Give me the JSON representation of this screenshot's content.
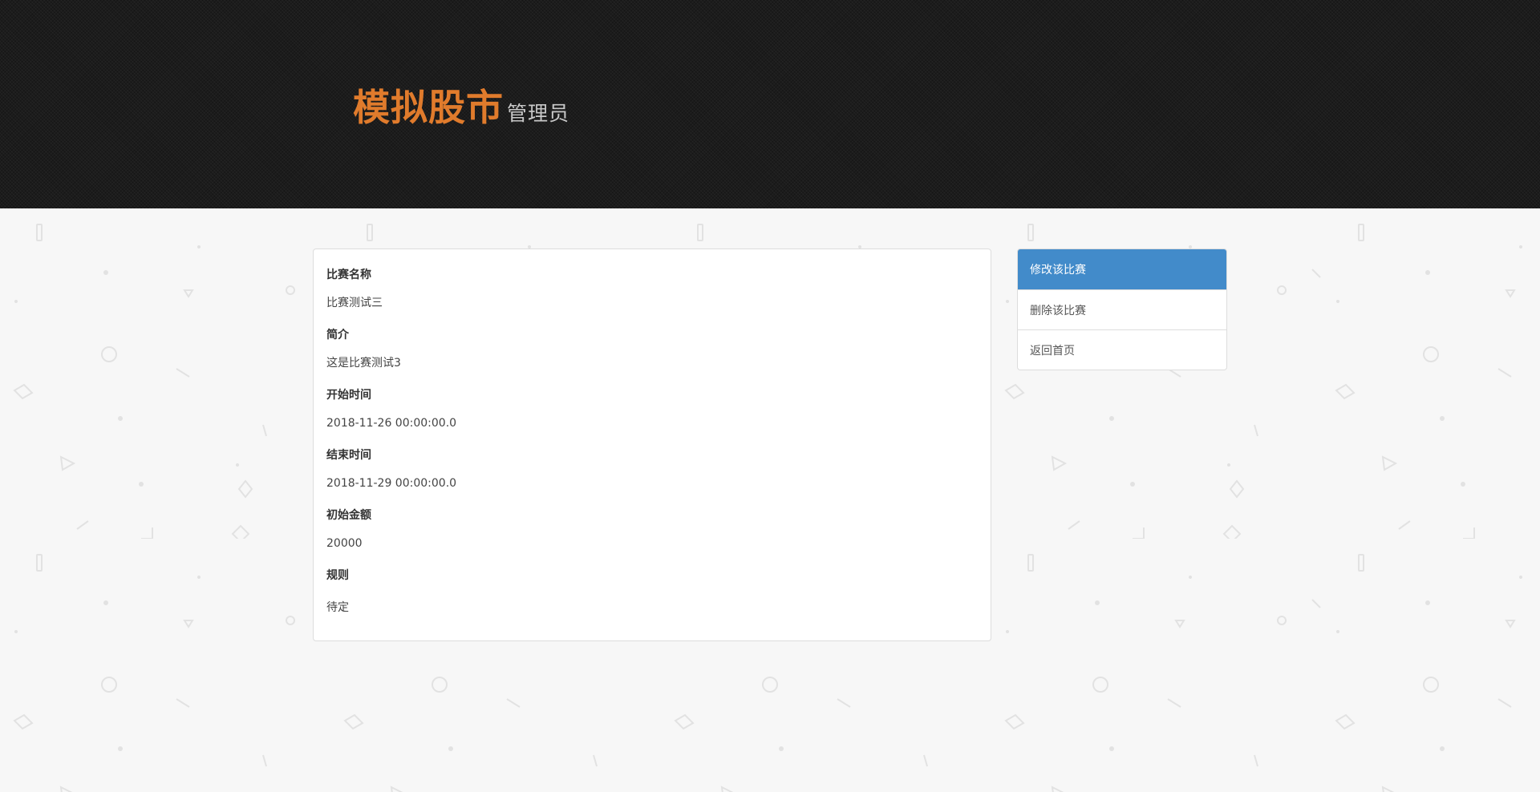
{
  "header": {
    "title": "模拟股市",
    "subtitle": "管理员"
  },
  "competition": {
    "fields": [
      {
        "label": "比赛名称",
        "value": "比赛测试三"
      },
      {
        "label": "简介",
        "value": "这是比赛测试3"
      },
      {
        "label": "开始时间",
        "value": "2018-11-26 00:00:00.0"
      },
      {
        "label": "结束时间",
        "value": "2018-11-29 00:00:00.0"
      },
      {
        "label": "初始金额",
        "value": "20000"
      },
      {
        "label": "规则",
        "value": "待定"
      }
    ]
  },
  "side_menu": {
    "items": [
      {
        "label": "修改该比赛",
        "active": true
      },
      {
        "label": "删除该比赛",
        "active": false
      },
      {
        "label": "返回首页",
        "active": false
      }
    ]
  },
  "colors": {
    "brand_orange": "#e07b2c",
    "header_bg": "#1c1c1c",
    "active_menu": "#428bca",
    "page_bg": "#f7f7f7"
  }
}
